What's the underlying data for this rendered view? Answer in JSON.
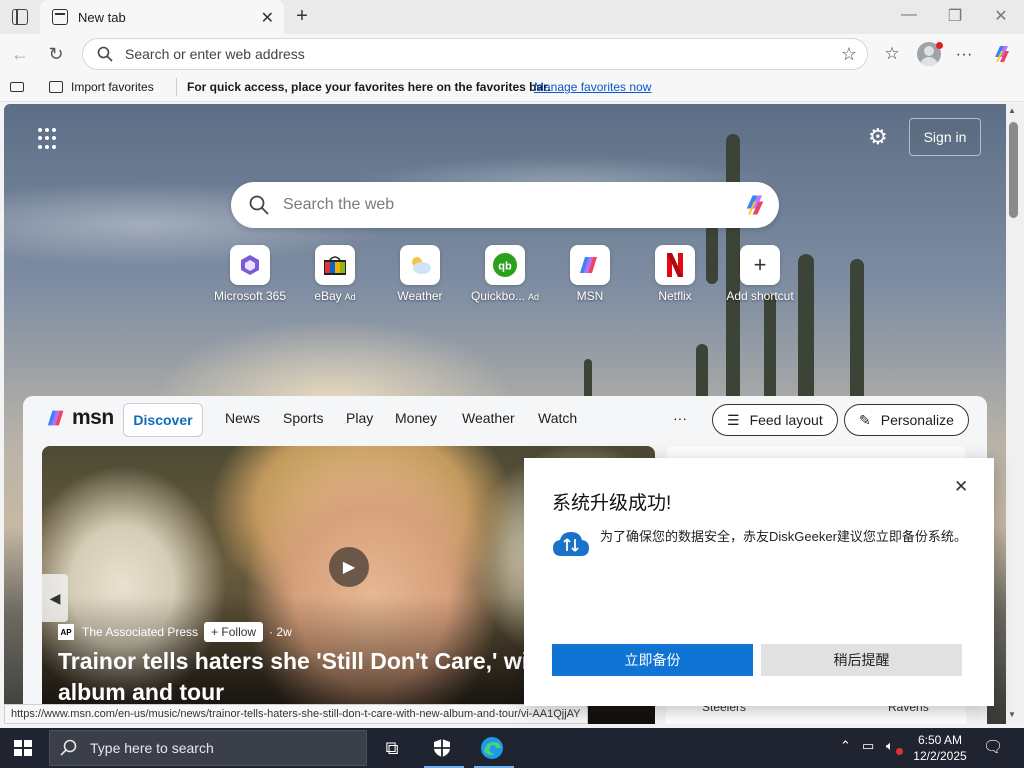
{
  "browser": {
    "tab_title": "New tab",
    "address_placeholder": "Search or enter web address"
  },
  "favorites_bar": {
    "import_label": "Import favorites",
    "message": "For quick access, place your favorites here on the favorites bar.",
    "manage_link": "Manage favorites now"
  },
  "newtab": {
    "signin_label": "Sign in",
    "search_placeholder": "Search the web",
    "shortcuts": [
      {
        "label": "Microsoft 365",
        "ad": "",
        "icon": "microsoft-365-icon"
      },
      {
        "label": "eBay",
        "ad": "Ad",
        "icon": "ebay-icon"
      },
      {
        "label": "Weather",
        "ad": "",
        "icon": "weather-icon"
      },
      {
        "label": "Quickbo...",
        "ad": "Ad",
        "icon": "quickbooks-icon"
      },
      {
        "label": "MSN",
        "ad": "",
        "icon": "msn-icon"
      },
      {
        "label": "Netflix",
        "ad": "",
        "icon": "netflix-icon"
      },
      {
        "label": "Add shortcut",
        "ad": "",
        "icon": "plus-icon"
      }
    ]
  },
  "msn": {
    "logo_text": "msn",
    "tabs": [
      "Discover",
      "News",
      "Sports",
      "Play",
      "Money",
      "Weather",
      "Watch"
    ],
    "more_label": "···",
    "feed_layout_label": "Feed layout",
    "personalize_label": "Personalize",
    "hero": {
      "source": "The Associated Press",
      "source_logo": "AP",
      "follow_label": "Follow",
      "age": "· 2w",
      "headline": "Trainor tells haters she 'Still Don't Care,' with new album and tour"
    },
    "side_card_peek": [
      "Steelers",
      "Ravens"
    ]
  },
  "status_url": "https://www.msn.com/en-us/music/news/trainor-tells-haters-she-still-don-t-care-with-new-album-and-tour/vi-AA1QjjAY",
  "popup": {
    "title": "系统升级成功!",
    "message": "为了确保您的数据安全，赤友DiskGeeker建议您立即备份系统。",
    "primary_button": "立即备份",
    "secondary_button": "稍后提醒"
  },
  "taskbar": {
    "search_placeholder": "Type here to search",
    "time": "6:50 AM",
    "date": "12/2/2025"
  },
  "colors": {
    "accent": "#0f74d4",
    "discover": "#0f6cbd",
    "taskbar": "#1f2430"
  }
}
